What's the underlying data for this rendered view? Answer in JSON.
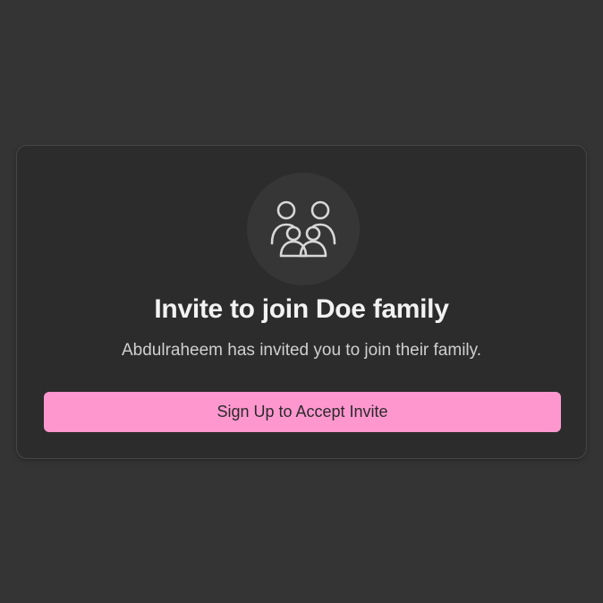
{
  "invite": {
    "icon": "family-icon",
    "title": "Invite to join Doe family",
    "message": "Abdulraheem has invited you to join their family.",
    "button_label": "Sign Up to Accept Invite"
  },
  "colors": {
    "background": "#343434",
    "card": "#2c2c2c",
    "accent": "#ff97cf"
  }
}
